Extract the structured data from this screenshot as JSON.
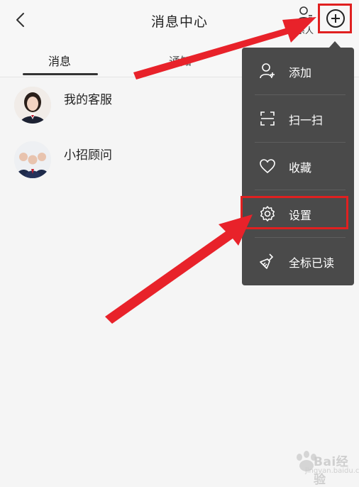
{
  "header": {
    "title": "消息中心",
    "contacts_label": "系人"
  },
  "tabs": [
    {
      "label": "消息",
      "active": true
    },
    {
      "label": "通知",
      "active": false
    }
  ],
  "conversations": [
    {
      "name": "我的客服"
    },
    {
      "name": "小招顾问"
    }
  ],
  "menu": {
    "items": [
      {
        "label": "添加",
        "icon": "add-person-icon"
      },
      {
        "label": "扫一扫",
        "icon": "scan-icon"
      },
      {
        "label": "收藏",
        "icon": "heart-icon"
      },
      {
        "label": "设置",
        "icon": "gear-icon"
      },
      {
        "label": "全标已读",
        "icon": "broom-icon"
      }
    ]
  },
  "watermark": {
    "brand": "Bai",
    "brand2": "经验",
    "sub": "jingyan.baidu.com"
  },
  "colors": {
    "highlight": "#e02020",
    "menu_bg": "#4a4a4a"
  }
}
